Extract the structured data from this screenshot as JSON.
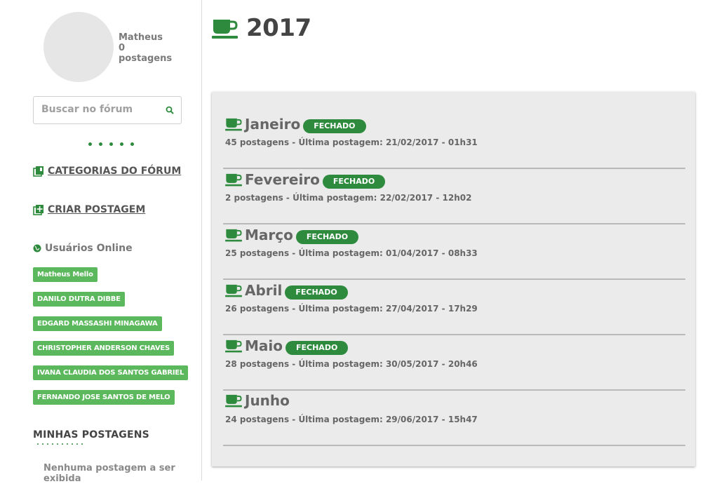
{
  "profile": {
    "name": "Matheus",
    "post_count": "0",
    "post_label": "postagens"
  },
  "search": {
    "placeholder": "Buscar no fórum",
    "icon": "search-icon"
  },
  "nav": {
    "categories_label": "CATEGORIAS DO FÓRUM",
    "create_label": "CRIAR POSTAGEM",
    "online_title": "Usuários Online"
  },
  "online_users": [
    "Matheus Mello",
    "DANILO DUTRA DIBBE",
    "EDGARD MASSASHI MINAGAWA",
    "CHRISTOPHER ANDERSON CHAVES",
    "IVANA CLAUDIA DOS SANTOS GABRIEL",
    "FERNANDO JOSE SANTOS DE MELO"
  ],
  "my_posts": {
    "title": "MINHAS POSTAGENS",
    "empty_text": "Nenhuma postagem a ser exibida"
  },
  "page": {
    "title": "2017",
    "icon": "coffee-cup-icon"
  },
  "months": [
    {
      "name": "Janeiro",
      "status": "FECHADO",
      "info": "45 postagens - Última postagem: 21/02/2017 - 01h31"
    },
    {
      "name": "Fevereiro",
      "status": "FECHADO",
      "info": "2 postagens - Última postagem: 22/02/2017 - 12h02"
    },
    {
      "name": "Março",
      "status": "FECHADO",
      "info": "25 postagens - Última postagem: 01/04/2017 - 08h33"
    },
    {
      "name": "Abril",
      "status": "FECHADO",
      "info": "26 postagens - Última postagem: 27/04/2017 - 17h29"
    },
    {
      "name": "Maio",
      "status": "FECHADO",
      "info": "28 postagens - Última postagem: 30/05/2017 - 20h46"
    },
    {
      "name": "Junho",
      "status": "",
      "info": "24 postagens - Última postagem: 29/06/2017 - 15h47"
    }
  ],
  "colors": {
    "accent": "#2e8b3e",
    "badge": "#5cb85c",
    "panel": "#ebebeb"
  }
}
